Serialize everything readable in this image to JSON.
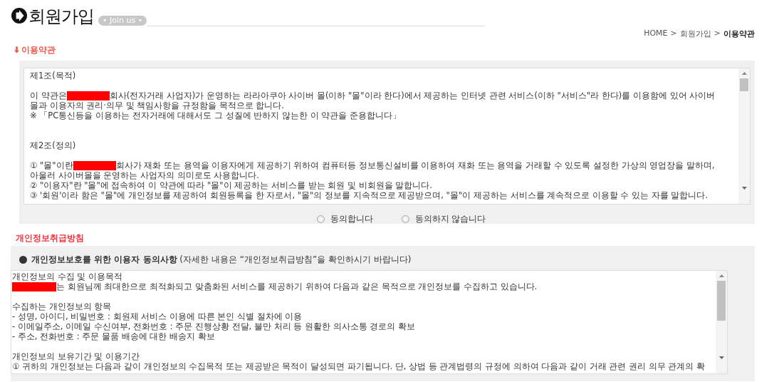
{
  "page_title": "회원가입",
  "title_badge": "• Join us •",
  "breadcrumb": [
    {
      "label": "HOME",
      "current": false
    },
    {
      "label": "회원가입",
      "current": false
    },
    {
      "label": "이용약관",
      "current": true
    }
  ],
  "breadcrumb_separator": ">",
  "terms": {
    "heading": "이용약관",
    "paragraphs": [
      {
        "wide_gap_before": false,
        "lines": [
          [
            {
              "kind": "text",
              "text": " 제1조(목적)"
            }
          ]
        ]
      },
      {
        "wide_gap_before": false,
        "lines": [
          [
            {
              "kind": "text",
              "text": "이 약관은 "
            },
            {
              "kind": "redaction"
            },
            {
              "kind": "text",
              "text": " 회사(전자거래 사업자)가 운영하는 라라아쿠아 사이버 몰(이하 \"몰\"이라 한다)에서 제공하는 인터넷 관련 서비스(이하 \"서비스\"라 한다)를 이용함에 있어 사이버"
            }
          ],
          [
            {
              "kind": "text",
              "text": "몰과 이용자의 권리·의무 및 책임사항을 규정함을 목적으로 합니다."
            }
          ],
          [
            {
              "kind": "text",
              "text": "※ 「PC통신등을 이용하는 전자거래에 대해서도 그 성질에 반하지 않는한 이 약관을 준용합니다」"
            }
          ]
        ]
      },
      {
        "wide_gap_before": true,
        "lines": [
          [
            {
              "kind": "text",
              "text": "제2조(정의)"
            }
          ]
        ]
      },
      {
        "wide_gap_before": false,
        "lines": [
          [
            {
              "kind": "text",
              "text": "① \"몰\"이란"
            },
            {
              "kind": "redaction"
            },
            {
              "kind": "text",
              "text": "회사가 재화 또는 용역을 이용자에게 제공하기 위하여 컴퓨터등 정보통신설비를 이용하여 재화 또는 용역을 거래할 수 있도록 설정한 가상의 영업장을 말하며,"
            }
          ],
          [
            {
              "kind": "text",
              "text": "아울러 사이버몰을 운영하는 사업자의 의미로도 사용합니다."
            }
          ],
          [
            {
              "kind": "text",
              "text": "② \"이용자\"란 \"몰\"에 접속하여 이 약관에 따라 \"몰\"이 제공하는 서비스를 받는 회원 및 비회원을 말합니다."
            }
          ],
          [
            {
              "kind": "text",
              "text": "③ '회원'이라 함은 \"몰\"에 개인정보를 제공하여 회원등록을 한 자로서, \"몰\"의 정보를 지속적으로 제공받으며, \"몰\"이 제공하는 서비스를 계속적으로 이용할 수 있는 자를 말합니다."
            }
          ]
        ]
      }
    ],
    "options": [
      {
        "label": "동의합니다",
        "selected": false
      },
      {
        "label": "동의하지 않습니다",
        "selected": false
      }
    ]
  },
  "privacy": {
    "heading": "개인정보취급방침",
    "notice_bold": "개인정보보호를 위한 이용자 동의사항",
    "notice_rest": "(자세한 내용은 “개인정보취급방침”을 확인하시기 바랍니다)",
    "paragraphs": [
      {
        "wide_gap_before": false,
        "lines": [
          [
            {
              "kind": "text",
              "text": "개인정보의 수집 및 이용목적"
            }
          ],
          [
            {
              "kind": "redaction"
            },
            {
              "kind": "text",
              "text": "는 회원님께 최대한으로 최적화되고 맞춤화된 서비스를 제공하기 위하여 다음과 같은 목적으로 개인정보를 수집하고 있습니다."
            }
          ]
        ]
      },
      {
        "wide_gap_before": false,
        "lines": [
          [
            {
              "kind": "text",
              "text": "수집하는 개인정보의 항목"
            }
          ],
          [
            {
              "kind": "text",
              "text": "- 성명, 아이디, 비밀번호 : 회원제 서비스 이용에 따른 본인 식별 절차에 이용"
            }
          ],
          [
            {
              "kind": "text",
              "text": "- 이메일주소, 이메일 수신여부, 전화번호 : 주문 진행상황 전달, 불만 처리 등 원활한 의사소통 경로의 확보"
            }
          ],
          [
            {
              "kind": "text",
              "text": "- 주소, 전화번호 : 주문 물품 배송에 대한 배송지 확보"
            }
          ]
        ]
      },
      {
        "wide_gap_before": false,
        "lines": [
          [
            {
              "kind": "text",
              "text": "개인정보의 보유기간 및 이용기간"
            }
          ],
          [
            {
              "kind": "text",
              "text": "① 귀하의 개인정보는 다음과 같이 개인정보의 수집목적 또는 제공받은 목적이 달성되면 파기됩니다. 단, 상법 등 관계법령의 규정에 의하여 다음과 같이 거래 관련 권리 의무 관계의 확"
            }
          ]
        ]
      }
    ]
  }
}
